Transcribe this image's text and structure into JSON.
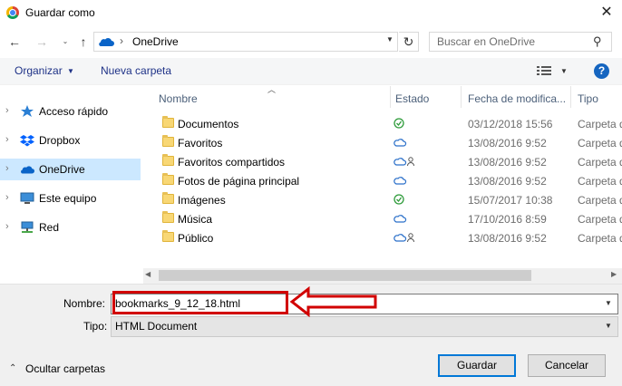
{
  "window": {
    "title": "Guardar como",
    "close_glyph": "✕"
  },
  "nav": {
    "back_glyph": "←",
    "forward_glyph": "→",
    "history_glyph": "⌄",
    "up_glyph": "↑",
    "address_sep": "›",
    "address": "OneDrive",
    "refresh_glyph": "↻",
    "search_placeholder": "Buscar en OneDrive"
  },
  "toolbar": {
    "organize": "Organizar",
    "new_folder": "Nueva carpeta",
    "help": "?"
  },
  "sidebar": {
    "items": [
      {
        "label": "Acceso rápido",
        "icon": "star-icon"
      },
      {
        "label": "Dropbox",
        "icon": "dropbox-icon"
      },
      {
        "label": "OneDrive",
        "icon": "cloud-icon",
        "selected": true
      },
      {
        "label": "Este equipo",
        "icon": "computer-icon"
      },
      {
        "label": "Red",
        "icon": "network-icon"
      }
    ]
  },
  "columns": {
    "name": "Nombre",
    "status": "Estado",
    "date": "Fecha de modifica...",
    "type": "Tipo"
  },
  "files": [
    {
      "name": "Documentos",
      "status": "synced",
      "date": "03/12/2018 15:56",
      "type": "Carpeta de"
    },
    {
      "name": "Favoritos",
      "status": "cloud",
      "date": "13/08/2016 9:52",
      "type": "Carpeta de"
    },
    {
      "name": "Favoritos compartidos",
      "status": "cloud-shared",
      "date": "13/08/2016 9:52",
      "type": "Carpeta de"
    },
    {
      "name": "Fotos de página principal",
      "status": "cloud",
      "date": "13/08/2016 9:52",
      "type": "Carpeta de"
    },
    {
      "name": "Imágenes",
      "status": "synced",
      "date": "15/07/2017 10:38",
      "type": "Carpeta de"
    },
    {
      "name": "Música",
      "status": "cloud",
      "date": "17/10/2016 8:59",
      "type": "Carpeta de"
    },
    {
      "name": "Público",
      "status": "cloud-shared",
      "date": "13/08/2016 9:52",
      "type": "Carpeta de"
    }
  ],
  "form": {
    "filename_label": "Nombre:",
    "filename_value": "bookmarks_9_12_18.html",
    "filetype_label": "Tipo:",
    "filetype_value": "HTML Document"
  },
  "footer": {
    "hide_folders": "Ocultar carpetas",
    "save": "Guardar",
    "cancel": "Cancelar"
  },
  "colors": {
    "accent": "#0078d7",
    "selected": "#cce8ff",
    "annotation": "#d10000",
    "link": "#1e3287"
  }
}
